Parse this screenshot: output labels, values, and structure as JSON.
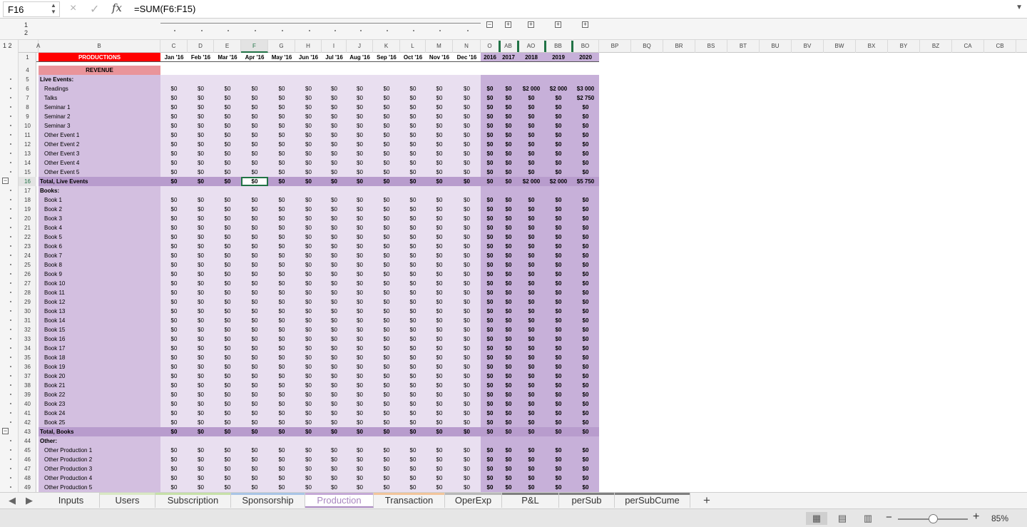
{
  "formula_bar": {
    "name_box": "F16",
    "cancel_icon": "×",
    "enter_icon": "✓",
    "fx_label": "fx",
    "formula": "=SUM(F6:F15)"
  },
  "outline": {
    "levels": [
      "1",
      "2"
    ],
    "level_label": "1 2"
  },
  "columns": [
    "A",
    "B",
    "C",
    "D",
    "E",
    "F",
    "G",
    "H",
    "I",
    "J",
    "K",
    "L",
    "M",
    "N",
    "O",
    "AB",
    "AO",
    "BB",
    "BO",
    "BP",
    "BQ",
    "BR",
    "BS",
    "BT",
    "BU",
    "BV",
    "BW",
    "BX",
    "BY",
    "BZ",
    "CA",
    "CB"
  ],
  "selected_cell": "F16",
  "header_row": {
    "title": "PRODUCTIONS",
    "months": [
      "Jan '16",
      "Feb '16",
      "Mar '16",
      "Apr '16",
      "May '16",
      "Jun '16",
      "Jul '16",
      "Aug '16",
      "Sep '16",
      "Oct '16",
      "Nov '16",
      "Dec '16"
    ],
    "years": [
      "2016",
      "2017",
      "2018",
      "2019",
      "2020"
    ]
  },
  "revenue_label": "REVENUE",
  "rows": [
    {
      "n": "5",
      "label": "Live Events:",
      "kind": "section"
    },
    {
      "n": "6",
      "label": "Readings",
      "kind": "item",
      "years": [
        "$0",
        "$0",
        "$2 000",
        "$2 000",
        "$3 000"
      ]
    },
    {
      "n": "7",
      "label": "Talks",
      "kind": "item",
      "years": [
        "$0",
        "$0",
        "$0",
        "$0",
        "$2 750"
      ]
    },
    {
      "n": "8",
      "label": "Seminar 1",
      "kind": "item"
    },
    {
      "n": "9",
      "label": "Seminar 2",
      "kind": "item"
    },
    {
      "n": "10",
      "label": "Seminar 3",
      "kind": "item"
    },
    {
      "n": "11",
      "label": "Other Event 1",
      "kind": "item"
    },
    {
      "n": "12",
      "label": "Other Event 2",
      "kind": "item"
    },
    {
      "n": "13",
      "label": "Other Event 3",
      "kind": "item"
    },
    {
      "n": "14",
      "label": "Other Event 4",
      "kind": "item"
    },
    {
      "n": "15",
      "label": "Other Event 5",
      "kind": "item"
    },
    {
      "n": "16",
      "label": "Total, Live Events",
      "kind": "total",
      "years": [
        "$0",
        "$0",
        "$2 000",
        "$2 000",
        "$5 750"
      ]
    },
    {
      "n": "17",
      "label": "Books:",
      "kind": "section"
    },
    {
      "n": "18",
      "label": "Book 1",
      "kind": "item"
    },
    {
      "n": "19",
      "label": "Book 2",
      "kind": "item"
    },
    {
      "n": "20",
      "label": "Book 3",
      "kind": "item"
    },
    {
      "n": "21",
      "label": "Book 4",
      "kind": "item"
    },
    {
      "n": "22",
      "label": "Book 5",
      "kind": "item"
    },
    {
      "n": "23",
      "label": "Book 6",
      "kind": "item"
    },
    {
      "n": "24",
      "label": "Book 7",
      "kind": "item"
    },
    {
      "n": "25",
      "label": "Book 8",
      "kind": "item"
    },
    {
      "n": "26",
      "label": "Book 9",
      "kind": "item"
    },
    {
      "n": "27",
      "label": "Book 10",
      "kind": "item"
    },
    {
      "n": "28",
      "label": "Book 11",
      "kind": "item"
    },
    {
      "n": "29",
      "label": "Book 12",
      "kind": "item"
    },
    {
      "n": "30",
      "label": "Book 13",
      "kind": "item"
    },
    {
      "n": "31",
      "label": "Book 14",
      "kind": "item"
    },
    {
      "n": "32",
      "label": "Book 15",
      "kind": "item"
    },
    {
      "n": "33",
      "label": "Book 16",
      "kind": "item"
    },
    {
      "n": "34",
      "label": "Book 17",
      "kind": "item"
    },
    {
      "n": "35",
      "label": "Book 18",
      "kind": "item"
    },
    {
      "n": "36",
      "label": "Book 19",
      "kind": "item"
    },
    {
      "n": "37",
      "label": "Book 20",
      "kind": "item"
    },
    {
      "n": "38",
      "label": "Book 21",
      "kind": "item"
    },
    {
      "n": "39",
      "label": "Book 22",
      "kind": "item"
    },
    {
      "n": "40",
      "label": "Book 23",
      "kind": "item"
    },
    {
      "n": "41",
      "label": "Book 24",
      "kind": "item"
    },
    {
      "n": "42",
      "label": "Book 25",
      "kind": "item"
    },
    {
      "n": "43",
      "label": "Total, Books",
      "kind": "total"
    },
    {
      "n": "44",
      "label": "Other:",
      "kind": "section"
    },
    {
      "n": "45",
      "label": "Other Production 1",
      "kind": "item"
    },
    {
      "n": "46",
      "label": "Other Production 2",
      "kind": "item"
    },
    {
      "n": "47",
      "label": "Other Production 3",
      "kind": "item"
    },
    {
      "n": "48",
      "label": "Other Production 4",
      "kind": "item"
    },
    {
      "n": "49",
      "label": "Other Production 5",
      "kind": "item"
    }
  ],
  "default_value": "$0",
  "sheet_tabs": [
    {
      "label": "Inputs",
      "color": "#f3f3f3"
    },
    {
      "label": "Users",
      "color": "#d9e8c4"
    },
    {
      "label": "Subscription",
      "color": "#c6e0a8"
    },
    {
      "label": "Sponsorship",
      "color": "#a9c4e6"
    },
    {
      "label": "Production",
      "color": "#c5a9d6",
      "active": true
    },
    {
      "label": "Transaction",
      "color": "#f2c49b"
    },
    {
      "label": "OperExp",
      "color": "#b8b8b8"
    },
    {
      "label": "P&L",
      "color": "#7f7f7f"
    },
    {
      "label": "perSub",
      "color": "#7f7f7f"
    },
    {
      "label": "perSubCume",
      "color": "#7f7f7f"
    }
  ],
  "add_sheet": "+",
  "zoom": {
    "level": "85%",
    "fraction": 0.5
  },
  "colors": {
    "label_bg": "#d3bfe0",
    "month_bg": "#e9dff0",
    "year_bg": "#c7b0d9",
    "total_bg": "#b89ccd",
    "header_red": "#ff0000",
    "revenue_bg": "#e9949a",
    "select_green": "#217346"
  }
}
